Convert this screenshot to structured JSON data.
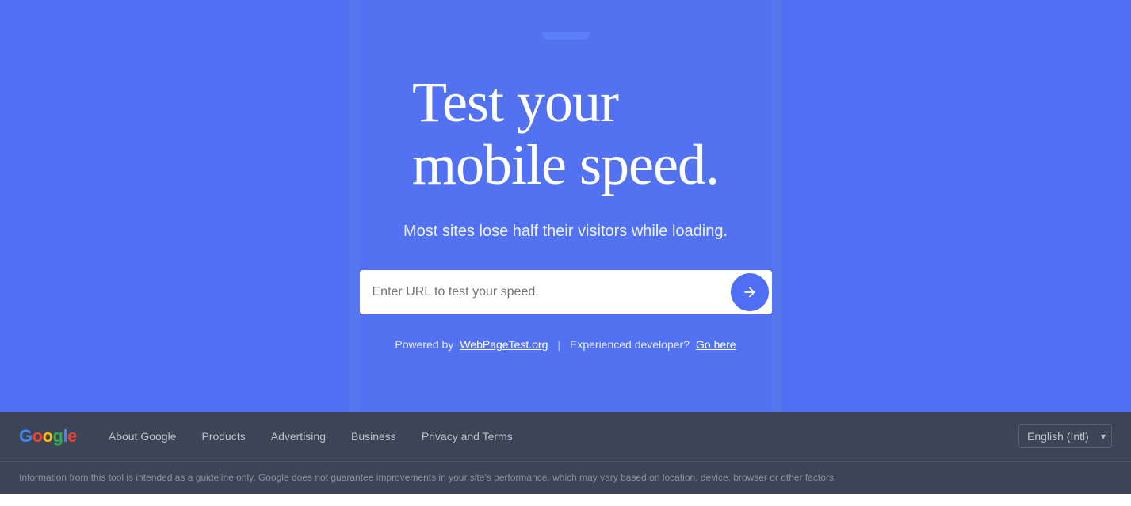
{
  "main": {
    "title_line1": "Test your",
    "title_line2": "mobile speed.",
    "subtitle": "Most sites lose half their visitors while loading.",
    "input_placeholder": "Enter URL to test your speed.",
    "powered_by_text": "Powered by",
    "powered_by_link": "WebPageTest.org",
    "developer_text": "Experienced developer?",
    "developer_link": "Go here"
  },
  "footer": {
    "logo": "Google",
    "links": [
      {
        "label": "About Google",
        "id": "about-google"
      },
      {
        "label": "Products",
        "id": "products"
      },
      {
        "label": "Advertising",
        "id": "advertising"
      },
      {
        "label": "Business",
        "id": "business"
      },
      {
        "label": "Privacy and Terms",
        "id": "privacy-terms"
      }
    ],
    "language": "English (Intl)",
    "disclaimer": "Information from this tool is intended as a guideline only. Google does not guarantee improvements in your site's performance, which may vary based on location, device, browser or other factors."
  },
  "colors": {
    "main_bg": "#4d6ef5",
    "card_bg": "#5272f2",
    "footer_bg": "#3c4555",
    "submit_btn": "#4d6ef5",
    "link_color": "#bdc1cb",
    "disclaimer_color": "#8a8f9e"
  },
  "icons": {
    "arrow_right": "→",
    "chevron_down": "▾"
  }
}
